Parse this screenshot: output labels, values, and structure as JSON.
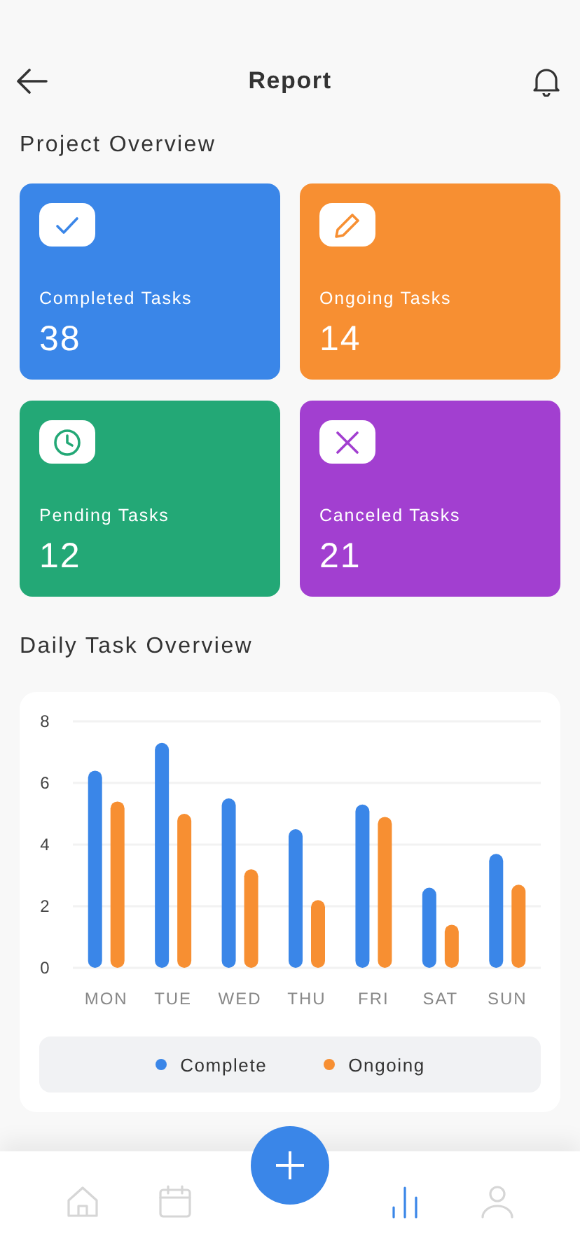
{
  "header": {
    "title": "Report"
  },
  "project_overview": {
    "title": "Project Overview",
    "cards": [
      {
        "kind": "check",
        "label": "Completed Tasks",
        "count": "38",
        "color": "#3a86e8"
      },
      {
        "kind": "pencil",
        "label": "Ongoing Tasks",
        "count": "14",
        "color": "#f78f32"
      },
      {
        "kind": "clock",
        "label": "Pending Tasks",
        "count": "12",
        "color": "#23a876"
      },
      {
        "kind": "cross",
        "label": "Canceled Tasks",
        "count": "21",
        "color": "#a23fd0"
      }
    ]
  },
  "daily_overview": {
    "title": "Daily Task Overview",
    "chart_data": {
      "type": "bar",
      "grid": true,
      "categories": [
        "MON",
        "TUE",
        "WED",
        "THU",
        "FRI",
        "SAT",
        "SUN"
      ],
      "ylim": [
        0,
        8
      ],
      "yticks": [
        0,
        2,
        4,
        6,
        8
      ],
      "series": [
        {
          "name": "Complete",
          "color": "#3a86e8",
          "values": [
            6.4,
            7.3,
            5.5,
            4.5,
            5.3,
            2.6,
            3.7
          ]
        },
        {
          "name": "Ongoing",
          "color": "#f78f32",
          "values": [
            5.4,
            5.0,
            3.2,
            2.2,
            4.9,
            1.4,
            2.7
          ]
        }
      ]
    }
  },
  "bottom_nav": {
    "items": [
      {
        "kind": "home",
        "selected": false
      },
      {
        "kind": "calendar",
        "selected": false
      },
      {
        "kind": "add",
        "selected": false
      },
      {
        "kind": "chart",
        "selected": true
      },
      {
        "kind": "profile",
        "selected": false
      }
    ]
  }
}
